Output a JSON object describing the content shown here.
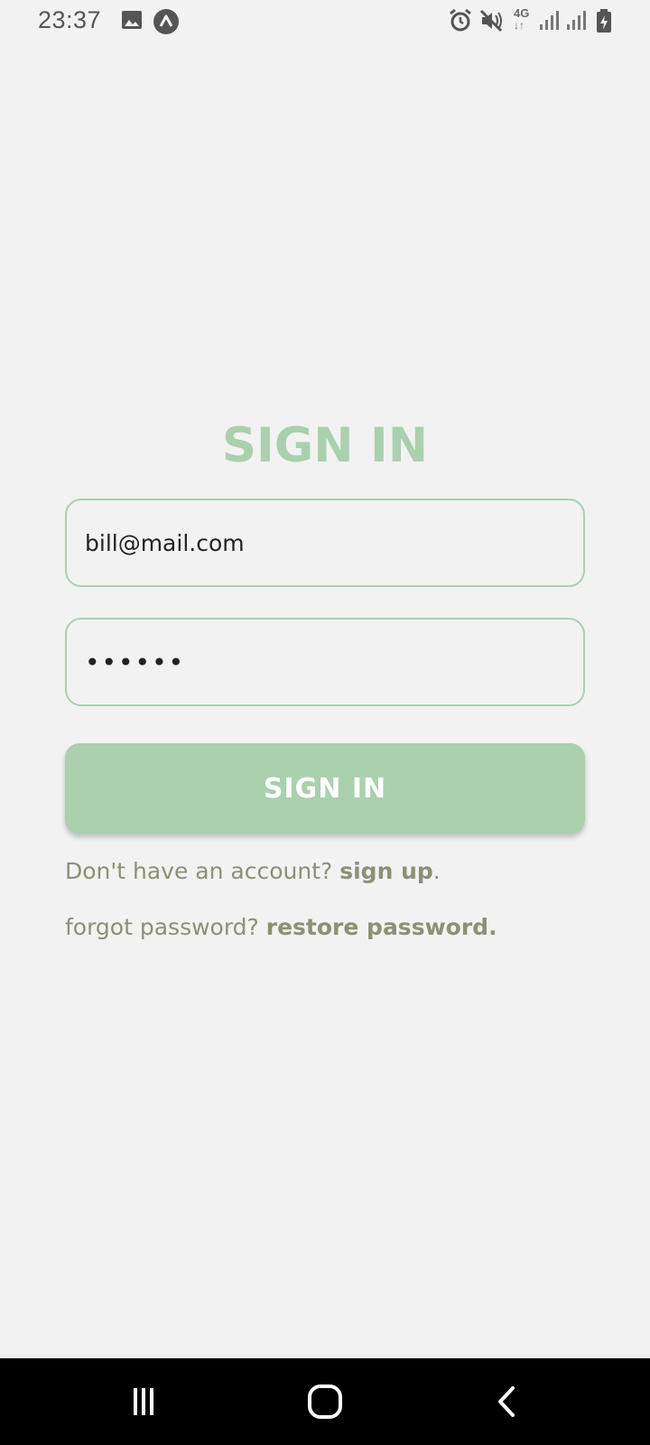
{
  "status_bar": {
    "time": "23:37",
    "network_type": "4G",
    "left_icons": [
      "gallery-icon",
      "app-notification-icon"
    ],
    "right_icons": [
      "alarm-icon",
      "mute-icon",
      "network-4g-icon",
      "signal-icon",
      "signal-icon-2",
      "battery-charging-icon"
    ]
  },
  "signin": {
    "title": "SIGN IN",
    "email_value": "bill@mail.com",
    "password_value": "••••••",
    "button_label": "SIGN IN",
    "signup_prompt": "Don't have an account? ",
    "signup_link": "sign up",
    "signup_suffix": ".",
    "forgot_prompt": "forgot password? ",
    "restore_link": "restore password."
  },
  "nav_bar": {
    "icons": [
      "recent-apps-icon",
      "home-icon",
      "back-icon"
    ]
  },
  "colors": {
    "accent": "#aad0ad",
    "background": "#f2f2f2",
    "helper_text": "#8b9176",
    "nav_background": "#000000"
  }
}
